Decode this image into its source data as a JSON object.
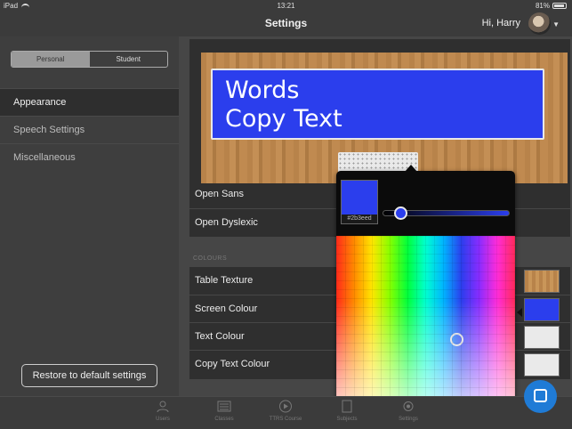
{
  "status": {
    "device": "iPad",
    "time": "13:21",
    "battery": "81%"
  },
  "nav": {
    "title": "Settings",
    "greeting": "Hi, Harry"
  },
  "sidebar": {
    "segments": [
      {
        "label": "Personal",
        "selected": true
      },
      {
        "label": "Student",
        "selected": false
      }
    ],
    "items": [
      {
        "label": "Appearance",
        "active": true
      },
      {
        "label": "Speech Settings",
        "active": false
      },
      {
        "label": "Miscellaneous",
        "active": false
      }
    ],
    "restore_label": "Restore to default settings"
  },
  "preview": {
    "line1": "Words",
    "line2": "Copy Text"
  },
  "fonts": [
    "Open Sans",
    "Open Dyslexic"
  ],
  "colours": {
    "section_label": "COLOURS",
    "rows": [
      {
        "label": "Table Texture",
        "swatch": "#c08a50"
      },
      {
        "label": "Screen Colour",
        "swatch": "#2b3eed"
      },
      {
        "label": "Text Colour",
        "swatch": "#eaeaea"
      },
      {
        "label": "Copy Text Colour",
        "swatch": "#eaeaea"
      }
    ]
  },
  "picker": {
    "hex": "#2b3eed",
    "brightness_fraction": 0.12
  },
  "tabs": [
    "Users",
    "Classes",
    "TTRS Course",
    "Subjects",
    "Settings"
  ],
  "colors": {
    "accent": "#2b3eed",
    "chat_button": "#1f7bd6"
  }
}
